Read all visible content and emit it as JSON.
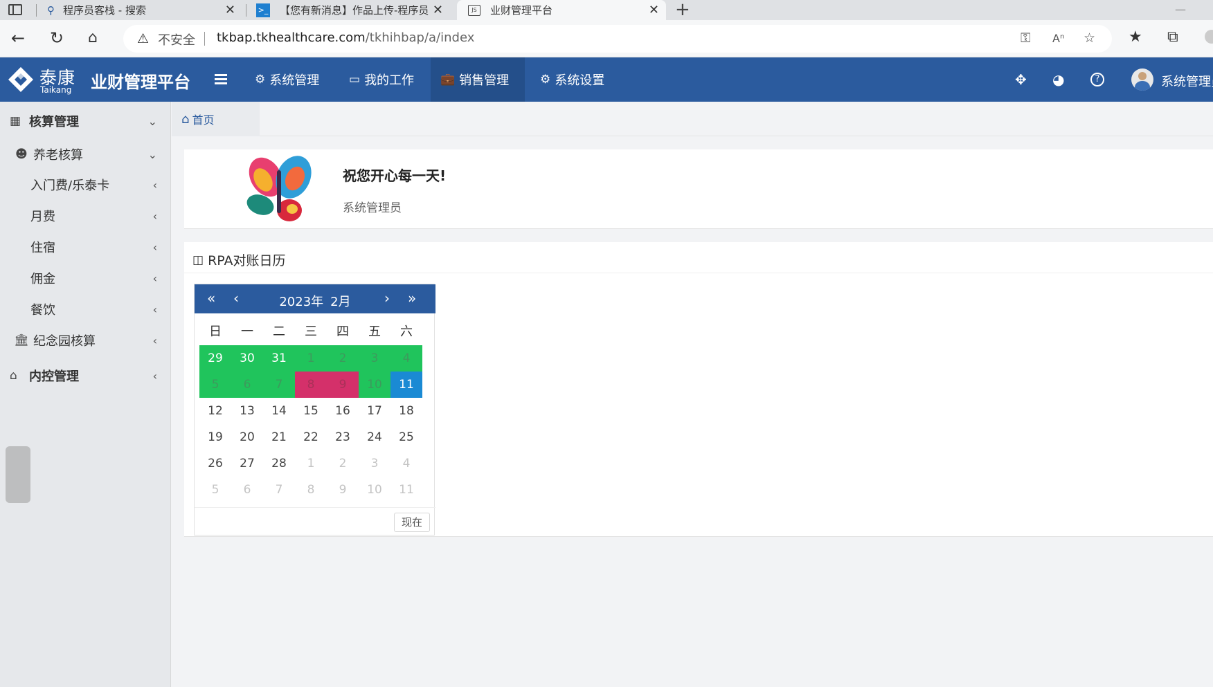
{
  "browser": {
    "tabs": [
      {
        "title": "程序员客栈 - 搜索",
        "icon": "search-icon"
      },
      {
        "title": "【您有新消息】作品上传-程序员",
        "icon": "terminal-icon"
      },
      {
        "title": "业财管理平台",
        "icon": "js-file-icon"
      }
    ],
    "insecure_label": "不安全",
    "url_host": "tkbap.tkhealthcare.com",
    "url_path": "/tkhihbap/a/index"
  },
  "header": {
    "logo_cn": "泰康",
    "logo_en": "Taikang",
    "app_title": "业财管理平台",
    "nav": [
      {
        "label": "系统管理",
        "icon": "gear-icon"
      },
      {
        "label": "我的工作",
        "icon": "monitor-icon"
      },
      {
        "label": "销售管理",
        "icon": "briefcase-icon",
        "active": true
      },
      {
        "label": "系统设置",
        "icon": "gear-icon"
      }
    ],
    "user_name": "系统管理员",
    "accent_color": "#2b5b9e"
  },
  "sidebar": {
    "items": [
      {
        "label": "核算管理",
        "icon": "table-icon",
        "level": 0,
        "arrow": "down"
      },
      {
        "label": "养老核算",
        "icon": "user-icon",
        "level": 1,
        "arrow": "down"
      },
      {
        "label": "入门费/乐泰卡",
        "level": 2,
        "arrow": "left"
      },
      {
        "label": "月费",
        "level": 2,
        "arrow": "left"
      },
      {
        "label": "住宿",
        "level": 2,
        "arrow": "left"
      },
      {
        "label": "佣金",
        "level": 2,
        "arrow": "left"
      },
      {
        "label": "餐饮",
        "level": 2,
        "arrow": "left"
      },
      {
        "label": "纪念园核算",
        "icon": "bank-icon",
        "level": 1,
        "arrow": "left"
      },
      {
        "label": "内控管理",
        "icon": "home-icon",
        "level": 0,
        "arrow": "left"
      }
    ]
  },
  "breadcrumb": {
    "home_label": "首页"
  },
  "welcome": {
    "title": "祝您开心每一天!",
    "subtitle": "系统管理员"
  },
  "calendar_card": {
    "title": "RPA对账日历",
    "year_label": "2023年",
    "month_label": "2月",
    "weekdays": [
      "日",
      "一",
      "二",
      "三",
      "四",
      "五",
      "六"
    ],
    "now_button": "现在",
    "weeks": [
      [
        {
          "d": "29",
          "s": "green"
        },
        {
          "d": "30",
          "s": "green"
        },
        {
          "d": "31",
          "s": "green"
        },
        {
          "d": "1",
          "s": "green other"
        },
        {
          "d": "2",
          "s": "green other"
        },
        {
          "d": "3",
          "s": "green other"
        },
        {
          "d": "4",
          "s": "green other"
        }
      ],
      [
        {
          "d": "5",
          "s": "green other"
        },
        {
          "d": "6",
          "s": "green other"
        },
        {
          "d": "7",
          "s": "green other"
        },
        {
          "d": "8",
          "s": "red"
        },
        {
          "d": "9",
          "s": "red"
        },
        {
          "d": "10",
          "s": "green other"
        },
        {
          "d": "11",
          "s": "today"
        }
      ],
      [
        {
          "d": "12",
          "s": ""
        },
        {
          "d": "13",
          "s": ""
        },
        {
          "d": "14",
          "s": ""
        },
        {
          "d": "15",
          "s": ""
        },
        {
          "d": "16",
          "s": ""
        },
        {
          "d": "17",
          "s": ""
        },
        {
          "d": "18",
          "s": ""
        }
      ],
      [
        {
          "d": "19",
          "s": ""
        },
        {
          "d": "20",
          "s": ""
        },
        {
          "d": "21",
          "s": ""
        },
        {
          "d": "22",
          "s": ""
        },
        {
          "d": "23",
          "s": ""
        },
        {
          "d": "24",
          "s": ""
        },
        {
          "d": "25",
          "s": ""
        }
      ],
      [
        {
          "d": "26",
          "s": ""
        },
        {
          "d": "27",
          "s": ""
        },
        {
          "d": "28",
          "s": ""
        },
        {
          "d": "1",
          "s": "greyed"
        },
        {
          "d": "2",
          "s": "greyed"
        },
        {
          "d": "3",
          "s": "greyed"
        },
        {
          "d": "4",
          "s": "greyed"
        }
      ],
      [
        {
          "d": "5",
          "s": "greyed"
        },
        {
          "d": "6",
          "s": "greyed"
        },
        {
          "d": "7",
          "s": "greyed"
        },
        {
          "d": "8",
          "s": "greyed"
        },
        {
          "d": "9",
          "s": "greyed"
        },
        {
          "d": "10",
          "s": "greyed"
        },
        {
          "d": "11",
          "s": "greyed"
        }
      ]
    ],
    "status_colors": {
      "reconciled": "#20c45c",
      "failed": "#d4306a",
      "today": "#1a8ad4"
    }
  }
}
